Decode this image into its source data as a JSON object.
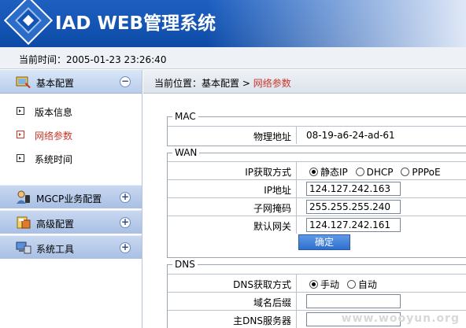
{
  "header": {
    "title": "IAD WEB管理系统"
  },
  "timebar": {
    "text": "当前时间：2005-01-23 23:26:40"
  },
  "sidebar": {
    "basic": {
      "label": "基本配置",
      "toggle": "−",
      "items": [
        {
          "label": "版本信息",
          "active": false
        },
        {
          "label": "网络参数",
          "active": true
        },
        {
          "label": "系统时间",
          "active": false
        }
      ]
    },
    "groups": [
      {
        "label": "MGCP业务配置",
        "toggle": "+",
        "icon": "phone-user-icon"
      },
      {
        "label": "高级配置",
        "toggle": "+",
        "icon": "advanced-config-icon"
      },
      {
        "label": "系统工具",
        "toggle": "+",
        "icon": "tools-computer-icon"
      }
    ]
  },
  "breadcrumb": {
    "prefix": "当前位置：基本配置 > ",
    "current": "网络参数"
  },
  "mac": {
    "legend": "MAC",
    "label": "物理地址",
    "value": "08-19-a6-24-ad-61"
  },
  "wan": {
    "legend": "WAN",
    "method_label": "IP获取方式",
    "options": [
      {
        "label": "静态IP",
        "selected": true
      },
      {
        "label": "DHCP",
        "selected": false
      },
      {
        "label": "PPPoE",
        "selected": false
      }
    ],
    "ip_label": "IP地址",
    "ip_value": "124.127.242.163",
    "mask_label": "子网掩码",
    "mask_value": "255.255.255.240",
    "gateway_label": "默认网关",
    "gateway_value": "124.127.242.161",
    "confirm_label": "确定"
  },
  "dns": {
    "legend": "DNS",
    "method_label": "DNS获取方式",
    "options": [
      {
        "label": "手动",
        "selected": true
      },
      {
        "label": "自动",
        "selected": false
      }
    ],
    "suffix_label": "域名后缀",
    "suffix_value": "",
    "primary_label": "主DNS服务器",
    "primary_value": ""
  },
  "watermark": "www.wooyun.org",
  "colors": {
    "header_blue": "#1454b3",
    "active_red": "#c8362a",
    "button_blue": "#2f6fce"
  }
}
